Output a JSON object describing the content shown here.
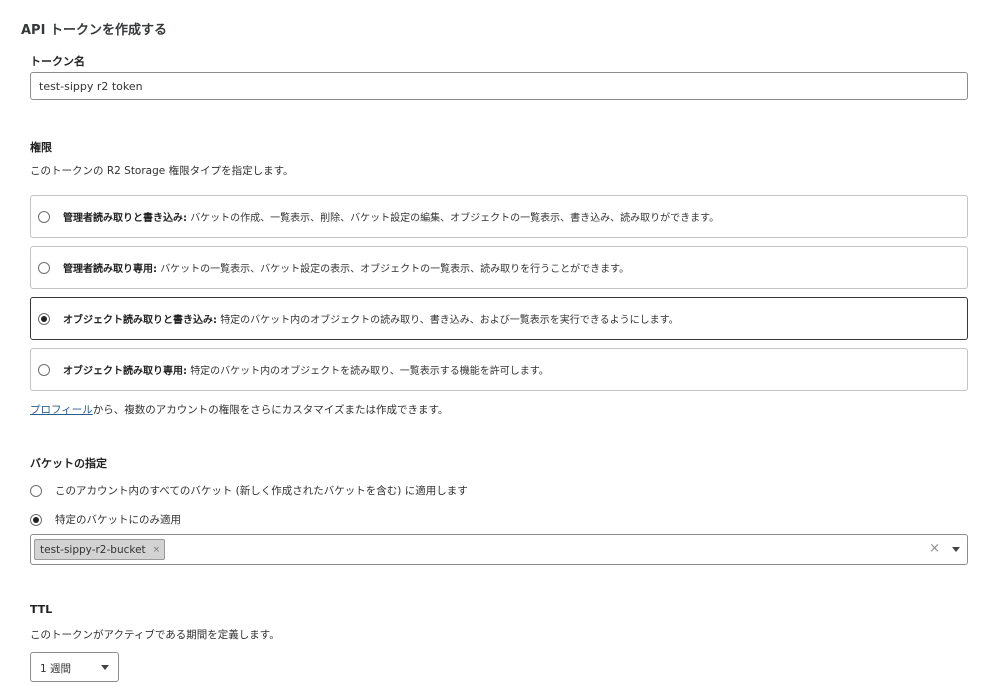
{
  "page": {
    "title": "API トークンを作成する"
  },
  "token_name": {
    "label": "トークン名",
    "value": "test-sippy r2 token"
  },
  "permissions": {
    "label": "権限",
    "description": "このトークンの R2 Storage 権限タイプを指定します。",
    "options": [
      {
        "title": "管理者読み取りと書き込み:",
        "description": "バケットの作成、一覧表示、削除、バケット設定の編集、オブジェクトの一覧表示、書き込み、読み取りができます。",
        "selected": false
      },
      {
        "title": "管理者読み取り専用:",
        "description": "バケットの一覧表示、バケット設定の表示、オブジェクトの一覧表示、読み取りを行うことができます。",
        "selected": false
      },
      {
        "title": "オブジェクト読み取りと書き込み:",
        "description": "特定のバケット内のオブジェクトの読み取り、書き込み、および一覧表示を実行できるようにします。",
        "selected": true
      },
      {
        "title": "オブジェクト読み取り専用:",
        "description": "特定のバケット内のオブジェクトを読み取り、一覧表示する機能を許可します。",
        "selected": false
      }
    ],
    "profile_link": "プロフィール",
    "profile_suffix": "から、複数のアカウントの権限をさらにカスタマイズまたは作成できます。"
  },
  "bucket_scope": {
    "label": "バケットの指定",
    "options": [
      {
        "label": "このアカウント内のすべてのバケット (新しく作成されたバケットを含む) に適用します",
        "selected": false
      },
      {
        "label": "特定のバケットにのみ適用",
        "selected": true
      }
    ],
    "selected_buckets": [
      "test-sippy-r2-bucket"
    ],
    "chip_remove": "×",
    "clear_all": "×"
  },
  "ttl": {
    "label": "TTL",
    "description": "このトークンがアクティブである期間を定義します。",
    "value": "1 週間"
  }
}
